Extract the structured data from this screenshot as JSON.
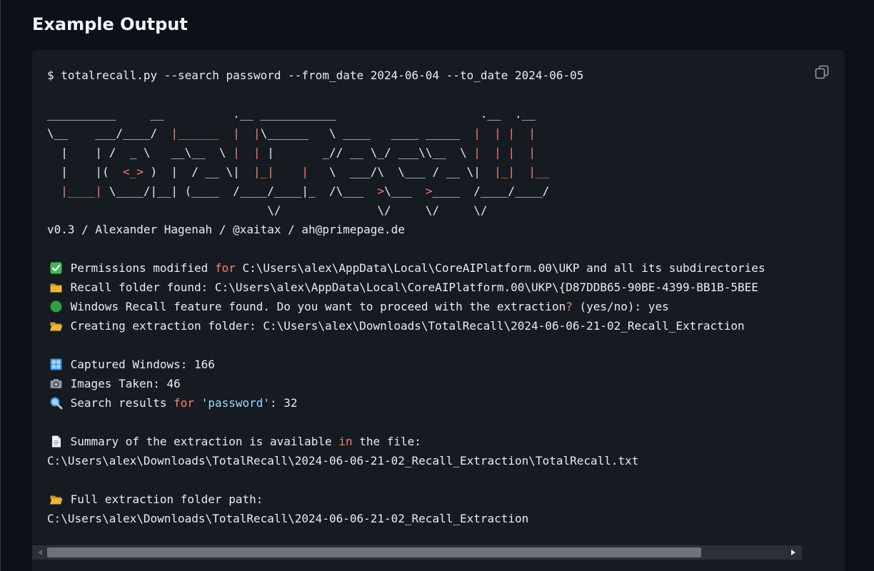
{
  "heading": "Example Output",
  "code": {
    "command": "$ totalrecall.py --search password --from_date 2024-06-04 --to_date 2024-06-05",
    "banner": [
      [
        {
          "t": "__________     __          .__ ___________                     .__  .__"
        }
      ],
      [
        {
          "t": "\\__    ___/____/  "
        },
        {
          "t": "|______",
          "c": "kw"
        },
        {
          "t": "  "
        },
        {
          "t": "|",
          "c": "kw"
        },
        {
          "t": "  "
        },
        {
          "t": "|",
          "c": "kw"
        },
        {
          "t": "\\______   \\ ____   ____ _____  "
        },
        {
          "t": "|",
          "c": "kw"
        },
        {
          "t": "  "
        },
        {
          "t": "|",
          "c": "kw"
        },
        {
          "t": " "
        },
        {
          "t": "|",
          "c": "kw"
        },
        {
          "t": "  "
        },
        {
          "t": "|",
          "c": "kw"
        }
      ],
      [
        {
          "t": "  |    | /  _ \\   __\\__  \\ "
        },
        {
          "t": "|",
          "c": "kw"
        },
        {
          "t": "  "
        },
        {
          "t": "|",
          "c": "kw"
        },
        {
          "t": " |       _// __ \\_/ ___\\\\__  \\ "
        },
        {
          "t": "|",
          "c": "kw"
        },
        {
          "t": "  "
        },
        {
          "t": "|",
          "c": "kw"
        },
        {
          "t": " "
        },
        {
          "t": "|",
          "c": "kw"
        },
        {
          "t": "  "
        },
        {
          "t": "|",
          "c": "kw"
        }
      ],
      [
        {
          "t": "  |    |( "
        },
        {
          "t": " <_>",
          "c": "kw"
        },
        {
          "t": " )  |  / __ \\|  "
        },
        {
          "t": "|_|",
          "c": "kw"
        },
        {
          "t": "    "
        },
        {
          "t": "|",
          "c": "kw"
        },
        {
          "t": "   \\  ___/\\  \\___ / __ \\|  "
        },
        {
          "t": "|_|",
          "c": "kw"
        },
        {
          "t": "  "
        },
        {
          "t": "|__",
          "c": "kw"
        }
      ],
      [
        {
          "t": "  "
        },
        {
          "t": "|____|",
          "c": "kw"
        },
        {
          "t": " \\____/|__| (____  /____/____|_  /\\___  "
        },
        {
          "t": ">",
          "c": "kw"
        },
        {
          "t": "\\___  "
        },
        {
          "t": ">",
          "c": "kw"
        },
        {
          "t": "____  /____/____/"
        }
      ],
      [
        {
          "t": "                                \\/              \\/     \\/     \\/"
        }
      ]
    ],
    "credits": "v0.3 / Alexander Hagenah / @xaitax / ah@primepage.de",
    "status_lines": [
      {
        "icon": "check-icon",
        "parts": [
          {
            "t": "Permissions modified "
          },
          {
            "t": "for",
            "c": "kw"
          },
          {
            "t": " C:\\Users\\alex\\AppData\\Local\\CoreAIPlatform.00\\UKP and all its subdirectories"
          }
        ]
      },
      {
        "icon": "folder-icon",
        "parts": [
          {
            "t": "Recall folder found: C:\\Users\\alex\\AppData\\Local\\CoreAIPlatform.00\\UKP\\{D87DDB65-90BE-4399-BB1B-5BEE"
          }
        ]
      },
      {
        "icon": "green-circle-icon",
        "parts": [
          {
            "t": "Windows Recall feature found. Do you want to proceed with the extraction"
          },
          {
            "t": "?",
            "c": "kw"
          },
          {
            "t": " (yes/no): yes"
          }
        ]
      },
      {
        "icon": "open-folder-icon",
        "parts": [
          {
            "t": "Creating extraction folder: C:\\Users\\alex\\Downloads\\TotalRecall\\2024-06-06-21-02_Recall_Extraction"
          }
        ]
      }
    ],
    "stats": [
      {
        "icon": "windows-icon",
        "parts": [
          {
            "t": "Captured Windows: 166"
          }
        ]
      },
      {
        "icon": "camera-icon",
        "parts": [
          {
            "t": "Images Taken: 46"
          }
        ]
      },
      {
        "icon": "magnifier-icon",
        "parts": [
          {
            "t": "Search results "
          },
          {
            "t": "for",
            "c": "kw"
          },
          {
            "t": " "
          },
          {
            "t": "'password'",
            "c": "str"
          },
          {
            "t": ": 32"
          }
        ]
      }
    ],
    "summary": {
      "icon": "document-icon",
      "parts": [
        {
          "t": "Summary of the extraction is available "
        },
        {
          "t": "in",
          "c": "kw"
        },
        {
          "t": " the file:"
        }
      ],
      "path": "C:\\Users\\alex\\Downloads\\TotalRecall\\2024-06-06-21-02_Recall_Extraction\\TotalRecall.txt"
    },
    "full_path": {
      "icon": "open-folder-icon",
      "label": "Full extraction folder path:",
      "path": "C:\\Users\\alex\\Downloads\\TotalRecall\\2024-06-06-21-02_Recall_Extraction"
    }
  },
  "colors": {
    "background": "#0d1117",
    "code_background": "#161b22",
    "text": "#e6edf3",
    "keyword": "#ff7b72",
    "string": "#a5d6ff"
  }
}
